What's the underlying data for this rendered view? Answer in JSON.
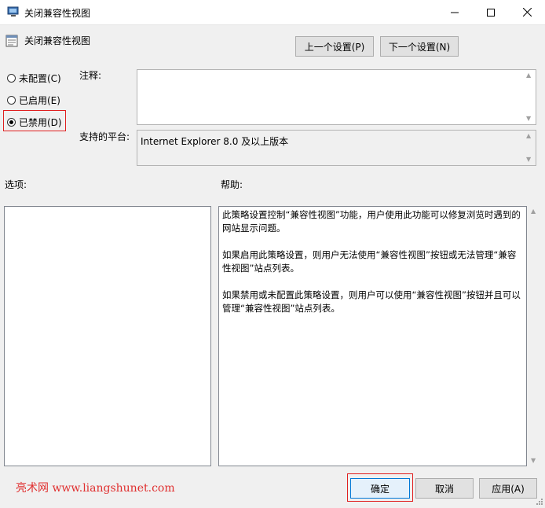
{
  "window": {
    "title": "关闭兼容性视图"
  },
  "header": {
    "policy_name": "关闭兼容性视图",
    "prev_label": "上一个设置(P)",
    "next_label": "下一个设置(N)"
  },
  "state": {
    "options": [
      {
        "label": "未配置(C)",
        "checked": false
      },
      {
        "label": "已启用(E)",
        "checked": false
      },
      {
        "label": "已禁用(D)",
        "checked": true
      }
    ]
  },
  "comment": {
    "label": "注释:",
    "value": ""
  },
  "platform": {
    "label": "支持的平台:",
    "value": "Internet Explorer 8.0 及以上版本"
  },
  "options_label": "选项:",
  "help": {
    "label": "帮助:",
    "paragraphs": [
      "此策略设置控制“兼容性视图”功能，用户使用此功能可以修复浏览时遇到的网站显示问题。",
      "如果启用此策略设置，则用户无法使用“兼容性视图”按钮或无法管理“兼容性视图”站点列表。",
      "如果禁用或未配置此策略设置，则用户可以使用“兼容性视图”按钮并且可以管理“兼容性视图”站点列表。"
    ]
  },
  "footer": {
    "watermark": "亮术网 www.liangshunet.com",
    "ok_label": "确定",
    "cancel_label": "取消",
    "apply_label": "应用(A)"
  },
  "colors": {
    "highlight_border": "#e02020",
    "ok_border": "#0078d7",
    "watermark": "#e03030"
  }
}
